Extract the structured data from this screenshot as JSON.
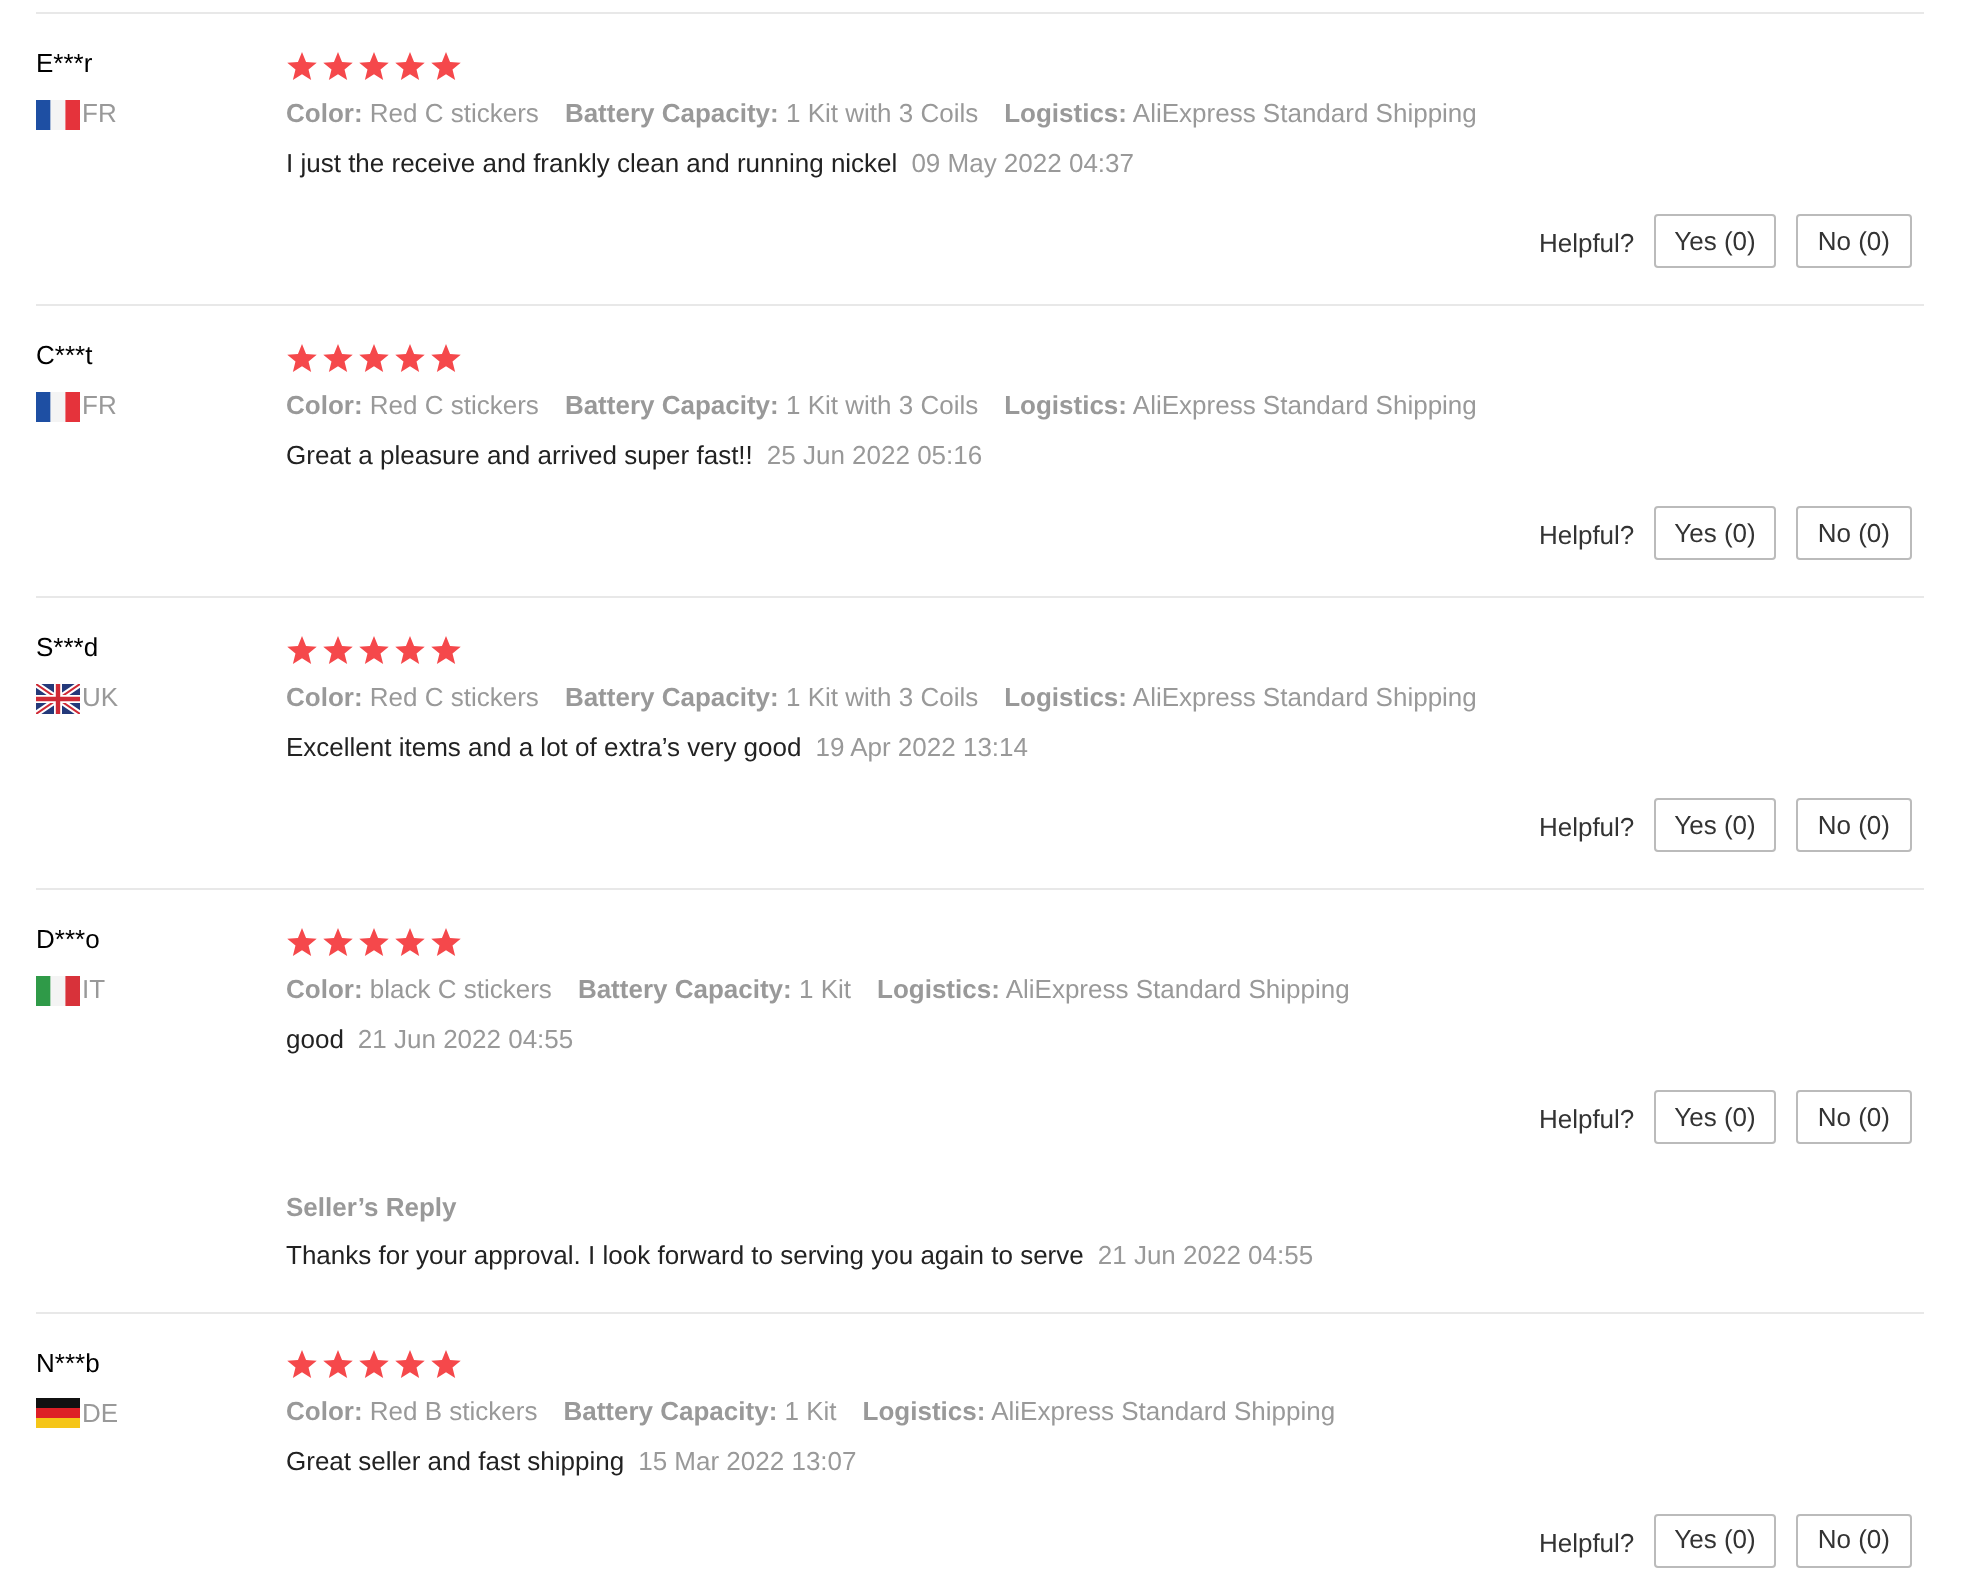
{
  "reviews": [
    {
      "name": "E***r",
      "flag": {
        "kind": "fr"
      },
      "country": "FR",
      "stars": 5,
      "properties": [
        {
          "label": "Color:",
          "value": "Red C stickers"
        },
        {
          "label": "Battery Capacity:",
          "value": "1 Kit with 3 Coils"
        },
        {
          "label": "Logistics:",
          "value": "AliExpress Standard Shipping"
        }
      ],
      "text": "I just the receive and frankly clean and running nickel",
      "date": "09 May 2022 04:37",
      "helpful": "Helpful?",
      "yes": "Yes (0)",
      "no": "No (0)"
    },
    {
      "name": "C***t",
      "flag": {
        "kind": "fr"
      },
      "country": "FR",
      "stars": 5,
      "properties": [
        {
          "label": "Color:",
          "value": "Red C stickers"
        },
        {
          "label": "Battery Capacity:",
          "value": "1 Kit with 3 Coils"
        },
        {
          "label": "Logistics:",
          "value": "AliExpress Standard Shipping"
        }
      ],
      "text": "Great a pleasure and arrived super fast!!",
      "date": "25 Jun 2022 05:16",
      "helpful": "Helpful?",
      "yes": "Yes (0)",
      "no": "No (0)"
    },
    {
      "name": "S***d",
      "flag": {
        "kind": "uk"
      },
      "country": "UK",
      "stars": 5,
      "properties": [
        {
          "label": "Color:",
          "value": "Red C stickers"
        },
        {
          "label": "Battery Capacity:",
          "value": "1 Kit with 3 Coils"
        },
        {
          "label": "Logistics:",
          "value": "AliExpress Standard Shipping"
        }
      ],
      "text": "Excellent items and a lot of extra’s very good",
      "date": "19 Apr 2022 13:14",
      "helpful": "Helpful?",
      "yes": "Yes (0)",
      "no": "No (0)"
    },
    {
      "name": "D***o",
      "flag": {
        "kind": "it"
      },
      "country": "IT",
      "stars": 5,
      "properties": [
        {
          "label": "Color:",
          "value": "black C stickers"
        },
        {
          "label": "Battery Capacity:",
          "value": "1 Kit"
        },
        {
          "label": "Logistics:",
          "value": "AliExpress Standard Shipping"
        }
      ],
      "text": "good",
      "date": "21 Jun 2022 04:55",
      "helpful": "Helpful?",
      "yes": "Yes (0)",
      "no": "No (0)",
      "seller_reply": {
        "title": "Seller’s Reply",
        "text": "Thanks for your approval. I look forward to serving you again to serve",
        "date": "21 Jun 2022 04:55"
      }
    },
    {
      "name": "N***b",
      "flag": {
        "kind": "de"
      },
      "country": "DE",
      "stars": 5,
      "properties": [
        {
          "label": "Color:",
          "value": "Red B stickers"
        },
        {
          "label": "Battery Capacity:",
          "value": "1 Kit"
        },
        {
          "label": "Logistics:",
          "value": "AliExpress Standard Shipping"
        }
      ],
      "text": "Great seller and fast shipping",
      "date": "15 Mar 2022 13:07",
      "helpful": "Helpful?",
      "yes": "Yes (0)",
      "no": "No (0)"
    }
  ]
}
